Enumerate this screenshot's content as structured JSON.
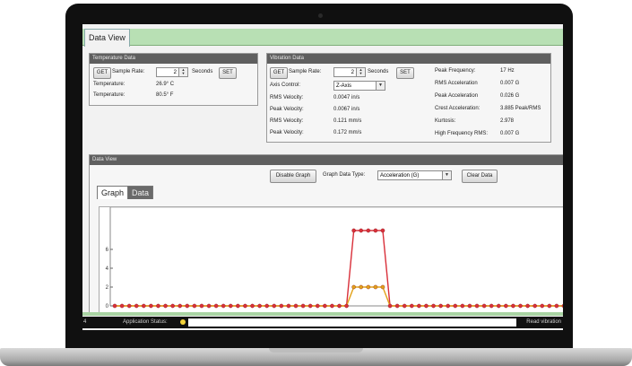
{
  "window": {
    "tab": "Data View"
  },
  "temperature": {
    "title": "Temperature Data",
    "get_label": "GET",
    "sample_rate_label": "Sample Rate:",
    "sample_rate_value": "2",
    "seconds_label": "Seconds",
    "set_label": "SET",
    "rows": [
      {
        "label": "Temperature:",
        "value": "26.9° C"
      },
      {
        "label": "Temperature:",
        "value": "80.5° F"
      }
    ]
  },
  "vibration": {
    "title": "Vibration Data",
    "get_label": "GET",
    "sample_rate_label": "Sample Rate:",
    "sample_rate_value": "2",
    "seconds_label": "Seconds",
    "set_label": "SET",
    "axis_control_label": "Axis Control:",
    "axis_control_value": "Z-Axis",
    "left_rows": [
      {
        "label": "RMS Velocity:",
        "value": "0.0047 in/s"
      },
      {
        "label": "Peak Velocity:",
        "value": "0.0067 in/s"
      },
      {
        "label": "RMS Velocity:",
        "value": "0.121 mm/s"
      },
      {
        "label": "Peak Velocity:",
        "value": "0.172 mm/s"
      }
    ],
    "right_rows": [
      {
        "label": "Peak Frequency:",
        "value": "17 Hz"
      },
      {
        "label": "RMS Acceleration",
        "value": "0.007 G"
      },
      {
        "label": "Peak Acceleration",
        "value": "0.026 G"
      },
      {
        "label": "Crest Acceleration:",
        "value": "3.885 Peak/RMS"
      },
      {
        "label": "Kurtosis:",
        "value": "2.978"
      },
      {
        "label": "High Frequency RMS:",
        "value": "0.007 G"
      }
    ]
  },
  "dataview": {
    "title": "Data View",
    "disable_graph_label": "Disable Graph",
    "graph_type_label": "Graph Data Type:",
    "graph_type_value": "Acceleration (G)",
    "clear_data_label": "Clear Data",
    "tabs": [
      "Graph",
      "Data"
    ],
    "y_ticks": [
      "6",
      "4",
      "2",
      "0"
    ]
  },
  "status": {
    "left": "4",
    "app_status_label": "Application Status:",
    "right": "Read vibration"
  },
  "colors": {
    "red_series": "#d9303a",
    "orange_series": "#e2a21a",
    "tab_green": "#b8e0b4"
  },
  "chart_data": {
    "type": "line",
    "ylim": [
      0,
      8
    ],
    "x": [
      1,
      2,
      3,
      4,
      5,
      6,
      7,
      8,
      9,
      10,
      11,
      12,
      13,
      14,
      15,
      16,
      17,
      18,
      19,
      20,
      21,
      22,
      23,
      24,
      25,
      26,
      27,
      28,
      29,
      30,
      31,
      32,
      33,
      34,
      35,
      36,
      37,
      38,
      39,
      40,
      41,
      42,
      43,
      44,
      45,
      46,
      47,
      48,
      49,
      50,
      51,
      52,
      53,
      54,
      55,
      56,
      57,
      58,
      59,
      60,
      61,
      62,
      63
    ],
    "series": [
      {
        "values": [
          0,
          0,
          0,
          0,
          0,
          0,
          0,
          0,
          0,
          0,
          0,
          0,
          0,
          0,
          0,
          0,
          0,
          0,
          0,
          0,
          0,
          0,
          0,
          0,
          0,
          0,
          0,
          0,
          0,
          0,
          0,
          0,
          0,
          8,
          8,
          8,
          8,
          8,
          0,
          0,
          0,
          0,
          0,
          0,
          0,
          0,
          0,
          0,
          0,
          0,
          0,
          0,
          0,
          0,
          0,
          0,
          0,
          0,
          0,
          0,
          0,
          0,
          0
        ]
      },
      {
        "values": [
          0,
          0,
          0,
          0,
          0,
          0,
          0,
          0,
          0,
          0,
          0,
          0,
          0,
          0,
          0,
          0,
          0,
          0,
          0,
          0,
          0,
          0,
          0,
          0,
          0,
          0,
          0,
          0,
          0,
          0,
          0,
          0,
          0,
          2,
          2,
          2,
          2,
          2,
          0,
          0,
          0,
          0,
          0,
          0,
          0,
          0,
          0,
          0,
          0,
          0,
          0,
          0,
          0,
          0,
          0,
          0,
          0,
          0,
          0,
          0,
          0,
          0,
          0
        ]
      }
    ]
  }
}
